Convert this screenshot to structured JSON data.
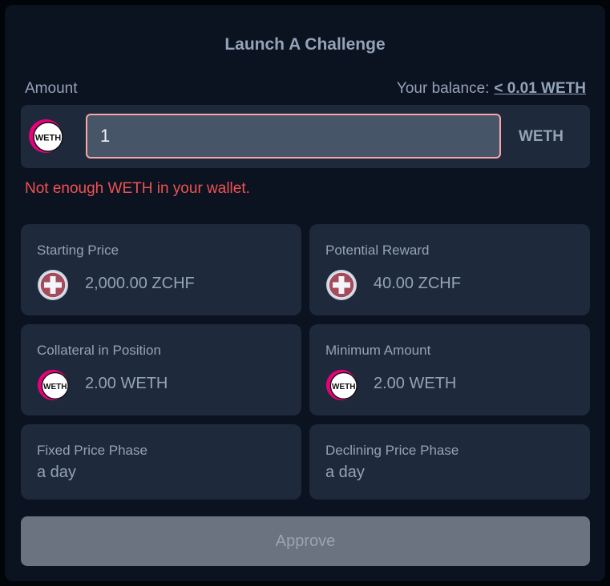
{
  "dialog": {
    "title": "Launch A Challenge"
  },
  "amount": {
    "label": "Amount",
    "balance_label": "Your balance:",
    "balance_value": "< 0.01 WETH",
    "input_value": "1",
    "unit": "WETH",
    "error": "Not enough WETH in your wallet."
  },
  "cards": {
    "starting_price": {
      "label": "Starting Price",
      "value": "2,000.00 ZCHF",
      "icon": "zchf-token-icon"
    },
    "potential_reward": {
      "label": "Potential Reward",
      "value": "40.00 ZCHF",
      "icon": "zchf-token-icon"
    },
    "collateral": {
      "label": "Collateral in Position",
      "value": "2.00 WETH",
      "icon": "weth-token-icon"
    },
    "minimum_amount": {
      "label": "Minimum Amount",
      "value": "2.00 WETH",
      "icon": "weth-token-icon"
    },
    "fixed_phase": {
      "label": "Fixed Price Phase",
      "value": "a day"
    },
    "declining_phase": {
      "label": "Declining Price Phase",
      "value": "a day"
    }
  },
  "actions": {
    "approve_label": "Approve"
  },
  "colors": {
    "background": "#010409",
    "panel": "#0b1220",
    "card": "#1e293b",
    "input": "#475569",
    "input_border_error": "#fca5a5",
    "error_text": "#f05252",
    "muted_text": "#94a3b8",
    "button_disabled": "#6b7280"
  }
}
